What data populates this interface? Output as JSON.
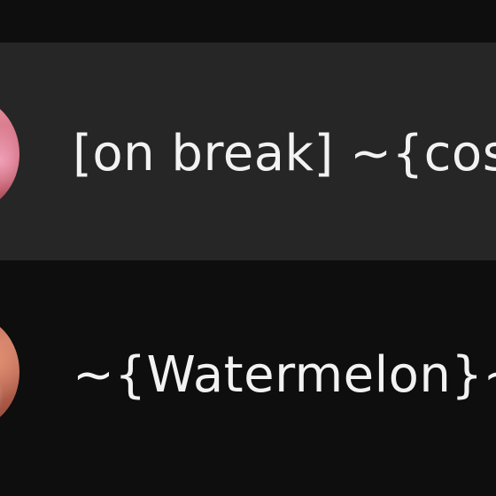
{
  "list": {
    "items": [
      {
        "name": "[on break] ~{cos",
        "selected": true
      },
      {
        "name": "~{Watermelon}~",
        "selected": false
      }
    ]
  },
  "colors": {
    "background": "#0e0e0e",
    "selected_row": "#262626",
    "text": "#f2f2f2"
  },
  "icons": [
    "avatar-image",
    "avatar-image"
  ]
}
